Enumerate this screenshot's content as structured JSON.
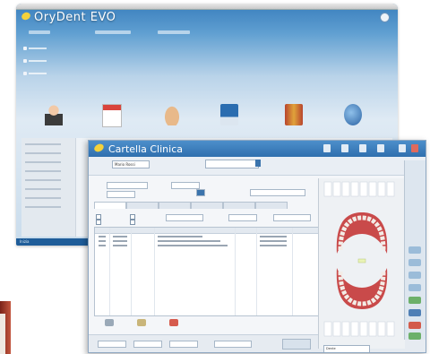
{
  "back_window": {
    "title": "OryDent EVO",
    "status_text": "Inizia"
  },
  "front_window": {
    "title": "Cartella Clinica",
    "patient_name": "Mario Rossi",
    "dropdown_value": "Dente"
  },
  "colors": {
    "title_blue": "#2f6fae",
    "accent_yellow": "#f4d13a",
    "gum_red": "#c94a4a"
  },
  "icons": {
    "back_tiles": [
      "person-icon",
      "calendar-icon",
      "hand-icon",
      "save-icon",
      "folder-icon",
      "globe-icon"
    ],
    "bottom_buttons": [
      "print-icon",
      "note-icon",
      "delete-icon"
    ]
  }
}
